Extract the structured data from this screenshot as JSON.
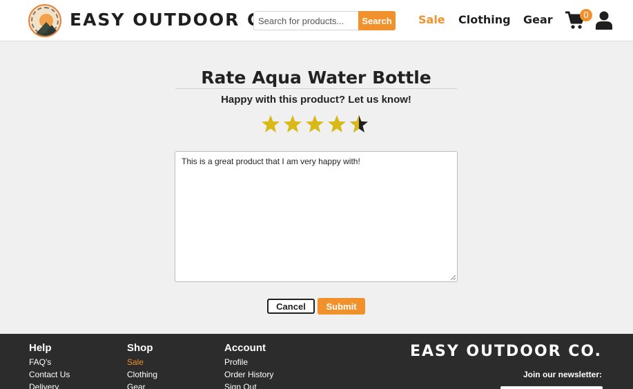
{
  "header": {
    "brand": "EASY OUTDOOR CO.",
    "logo_text": "EASY OUTDOOR",
    "search": {
      "placeholder": "Search for products...",
      "button_label": "Search"
    },
    "nav": [
      {
        "label": "Sale"
      },
      {
        "label": "Clothing"
      },
      {
        "label": "Gear"
      }
    ],
    "cart_count": "0",
    "colors": {
      "accent": "#f0912b",
      "text": "#1f1f1f"
    }
  },
  "main": {
    "title": "Rate Aqua Water Bottle",
    "subtitle": "Happy with this product? Let us know!",
    "rating": {
      "value": 4.5,
      "max": 5,
      "star_color": "#d9b916"
    },
    "review_text": "This is a great product that I am very happy with!",
    "buttons": {
      "cancel": "Cancel",
      "submit": "Submit"
    }
  },
  "footer": {
    "help": {
      "heading": "Help",
      "links": [
        "FAQ's",
        "Contact Us",
        "Delivery"
      ]
    },
    "shop": {
      "heading": "Shop",
      "links": [
        "Sale",
        "Clothing",
        "Gear"
      ]
    },
    "account": {
      "heading": "Account",
      "links": [
        "Profile",
        "Order History",
        "Sign Out"
      ]
    },
    "brand": "EASY OUTDOOR CO.",
    "newsletter_label": "Join our newsletter:",
    "background": "#2c2c2c"
  }
}
